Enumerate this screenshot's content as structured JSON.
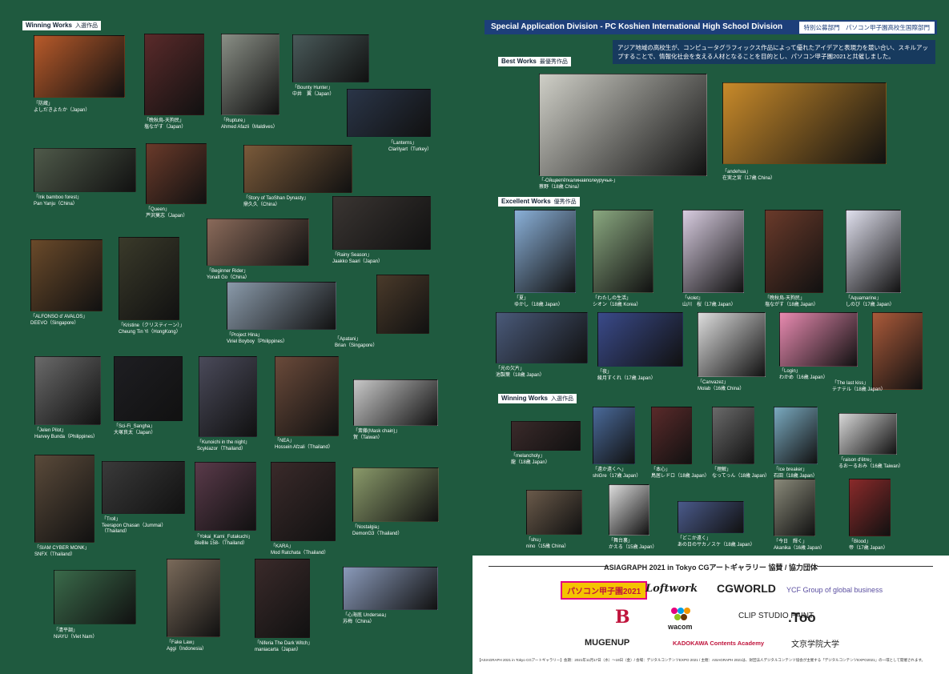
{
  "left": {
    "section": {
      "en": "Winning Works",
      "jp": "入選作品"
    },
    "works": [
      {
        "title": "「防蔵」",
        "author": "よしだきよたか（Japan）"
      },
      {
        "title": "「晩秋烏-天狗民」",
        "author": "塩ながす（Japan）"
      },
      {
        "title": "「Rupture」",
        "author": "Ahmed Afazli（Maldives）"
      },
      {
        "title": "「Bounty Hunter」",
        "author": "中井　翼（Japan）"
      },
      {
        "title": "「Lanterns」",
        "author": "Clarityart（Turkey）"
      },
      {
        "title": "「Ink bamboo forest」",
        "author": "Pan Yanju（China）"
      },
      {
        "title": "「Queen」",
        "author": "芦沢莫志（Japan）"
      },
      {
        "title": "「Story of TaoShan Dynasty」",
        "author": "鼎久久（China）"
      },
      {
        "title": "「Beginner Rider」",
        "author": "Yonalt Go（China）"
      },
      {
        "title": "「Rainy Season」",
        "author": "Jaakko Saari（Japan）"
      },
      {
        "title": "「ALFONSO d' AVALOS」",
        "author": "DEEVO（Singapore）"
      },
      {
        "title": "「Kristine（クリスティーン）」",
        "author": "Cheung Tin Yi（HongKong）"
      },
      {
        "title": "「Project Hina」",
        "author": "Viriel Boyboy（Philippines）"
      },
      {
        "title": "「Apatani」",
        "author": "Brian（Singapore）"
      },
      {
        "title": "「Jelen Pilot」",
        "author": "Harvey Bunda（Philippines）"
      },
      {
        "title": "「Sci-Fi_Sangha」",
        "author": "大塚良太（Japan）"
      },
      {
        "title": "「Kunoichi in the night」",
        "author": "Scykiazor（Thailand）"
      },
      {
        "title": "「NEA」",
        "author": "Hossein Afzali（Thailand）"
      },
      {
        "title": "「斎藤(Mask chain)」",
        "author": "賀（Taiwan）"
      },
      {
        "title": "「SIAM CYBER MONK」",
        "author": "SNFX（Thailand）"
      },
      {
        "title": "「Troll」",
        "author": "Teerapon Chasan（Jummai）",
        "extra": "（Thailand）"
      },
      {
        "title": "「Yokai_Kami_Futakuchi」",
        "author": "BleBle 158-（Thailand）"
      },
      {
        "title": "「KARA」",
        "author": "Mod Ratchata（Thailand）"
      },
      {
        "title": "「Nostalgia」",
        "author": "DemonG3（Thailand）"
      },
      {
        "title": "「清平調」",
        "author": "NIAYU（Viet Nam）"
      },
      {
        "title": "「Fake Law」",
        "author": "Aggi（Indonesia）"
      },
      {
        "title": "「Niferia The Dark Witch」",
        "author": "maniacarta（Japan）"
      },
      {
        "title": "「心海底 Undersea」",
        "author": "苏梅（China）"
      }
    ]
  },
  "right": {
    "header_title": "Special Application Division - PC Koshien International High School Division",
    "header_jp": "特別公募部門　パソコン甲子園高校生国際部門",
    "intro": "アジア地域の高校生が、コンピュータグラフィックス作品によって優れたアイデアと表現力を競い合い、スキルアップすることで、情報化社会を支える人材となることを目的とし、パソコン甲子園2021と共催しました。",
    "best": {
      "en": "Best Works",
      "jp": "最優秀作品"
    },
    "best_works": [
      {
        "title": "「-Ойщветёткалинавполеуручья-」",
        "author": "蔡野（18歳 China）"
      },
      {
        "title": "「andehua」",
        "author": "在実之宮（17歳 China）"
      }
    ],
    "excellent": {
      "en": "Excellent Works",
      "jp": "優秀作品"
    },
    "excellent_works": [
      {
        "title": "「夏」",
        "author": "ゆかし（18歳 Japan）"
      },
      {
        "title": "「わたしの生活」",
        "author": "シオン（18歳 Korea）"
      },
      {
        "title": "「violet」",
        "author": "山川　桜（17歳 Japan）"
      },
      {
        "title": "「晩秋烏-天狗民」",
        "author": "塩ながす（18歳 Japan）"
      },
      {
        "title": "「Aquamarine」",
        "author": "しのび（17歳 Japan）"
      },
      {
        "title": "「光の欠片」",
        "author": "池製葉（18歳 Japan）"
      },
      {
        "title": "「夜」",
        "author": "綾月すくれ（17歳 Japan）"
      },
      {
        "title": "「Canvazez」",
        "author": "Molab（16歳 China）"
      },
      {
        "title": "「Login」",
        "author": "わかめ（16歳 Japan）"
      },
      {
        "title": "「The last kiss」",
        "author": "テナテル（18歳 Japan）"
      }
    ],
    "winning": {
      "en": "Winning Works",
      "jp": "入選作品"
    },
    "winning_works": [
      {
        "title": "「melancholy」",
        "author": "龍（18歳 Japan）"
      },
      {
        "title": "「遠か遠くへ」",
        "author": "shiGre（17歳 Japan）"
      },
      {
        "title": "「本心」",
        "author": "鳥居レドロ（18歳 Japan）"
      },
      {
        "title": "「理解」",
        "author": "なってっん（18歳 Japan）"
      },
      {
        "title": "「Ice breaker」",
        "author": "石田（18歳 Japan）"
      },
      {
        "title": "「raison d'être」",
        "author": "るおーるおみ（16歳 Taiwan）"
      },
      {
        "title": "「shu」",
        "author": "nino（15歳 China）"
      },
      {
        "title": "「舞台裏」",
        "author": "かえる（15歳 Japan）"
      },
      {
        "title": "「どこか遠く」",
        "author": "あの日のサカノスケ（18歳 Japan）"
      },
      {
        "title": "「今日　輝く」",
        "author": "Akanika（16歳 Japan）"
      },
      {
        "title": "「Blood」",
        "author": "帝（17歳 Japan）"
      }
    ]
  },
  "sponsors": {
    "title": "ASIAGRAPH 2021 in Tokyo  CGアートギャラリー 協賛 / 協力団体",
    "logos": [
      "パソコン甲子園2021",
      "Loftwork",
      "CGWORLD",
      "YCF Group of global business",
      "B",
      "wacom",
      "CLIP STUDIO PAINT",
      ".Too",
      "MUGENUP",
      "KADOKAWA Contents Academy",
      "文京学院大学"
    ],
    "footnote": "【ASIAGRAPH 2021 in Tokyo CGアートギャラリー】会期：2021年11月17日（水）〜19日（金）/ 会場：デジタルコンテンツEXPO 2021 / 主催：ASIAGRAPH 2021は、財団法人デジタルコンテンツ協会が主催する「デジタルコンテンツEXPO2021」の一環として開催されます。"
  },
  "colors": {
    "background": "#1f5a3f",
    "header": "#1d3f7a",
    "intro_bg": "#173a5e"
  }
}
